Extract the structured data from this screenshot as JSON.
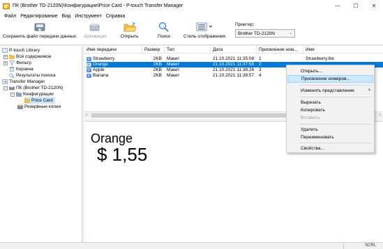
{
  "window": {
    "title": "ПК (Brother TD-2120N)\\Конфигурации\\Price Card - P-touch Transfer Manager",
    "minimize": "—",
    "maximize": "☐",
    "close": "✕"
  },
  "menu": [
    "Файл",
    "Редактирование",
    "Вид",
    "Инструмент",
    "Справка"
  ],
  "toolbar": {
    "save_transfer": "Сохранить файл передачи данных",
    "archive": "Архивация",
    "open": "Открыть",
    "search": "Поиск",
    "view_style": "Стиль отображения",
    "printer_label": "Принтер:",
    "printer_value": "Brother TD-2120N"
  },
  "tree": [
    {
      "label": "P-touch Library"
    },
    {
      "label": "Всё содержимое",
      "expander": "+"
    },
    {
      "label": "Фильтр",
      "expander": "+"
    },
    {
      "label": "Корзина"
    },
    {
      "label": "Результаты поиска"
    },
    {
      "label": "Transfer Manager"
    },
    {
      "label": "ПК (Brother TD-2120N)",
      "expander": "−"
    },
    {
      "label": "Конфигурации",
      "expander": "−"
    },
    {
      "label": "Price Card"
    },
    {
      "label": "Резервные копии"
    }
  ],
  "list": {
    "columns": [
      "Имя передачи",
      "Размер",
      "Тип",
      "Дата",
      "Присвоение ном...",
      "Имя"
    ],
    "rows": [
      {
        "name": "Strawberry",
        "size": "2KB",
        "type": "Макет",
        "date": "21.10.2021 11:35:08",
        "num": "1",
        "file": "Strawberry.lbx",
        "selected": false
      },
      {
        "name": "Orange",
        "size": "2KB",
        "type": "Макет",
        "date": "21.10.2021 11:37:59",
        "num": "2",
        "file": "",
        "selected": true
      },
      {
        "name": "Apple",
        "size": "2KB",
        "type": "Макет",
        "date": "21.10.2021 11:38:26",
        "num": "3",
        "file": "",
        "selected": false
      },
      {
        "name": "Banana",
        "size": "2KB",
        "type": "Макет",
        "date": "21.10.2021 11:38:57",
        "num": "4",
        "file": "",
        "selected": false
      }
    ]
  },
  "preview": {
    "line1": "Orange",
    "line2": "$ 1,55"
  },
  "context_menu": {
    "open": "Открыть...",
    "assign_numbers": "Присвоение номеров...",
    "change_view": "Изменить представление",
    "change_view_arrow": ">",
    "cut": "Вырезать",
    "copy": "Копировать",
    "paste": "Вставить",
    "delete": "Удалить",
    "rename": "Переименовать",
    "properties": "Свойства..."
  },
  "status": {
    "scrl": "SCRL"
  },
  "colors": {
    "selection": "#0078d7",
    "hover": "#cce8ff"
  }
}
